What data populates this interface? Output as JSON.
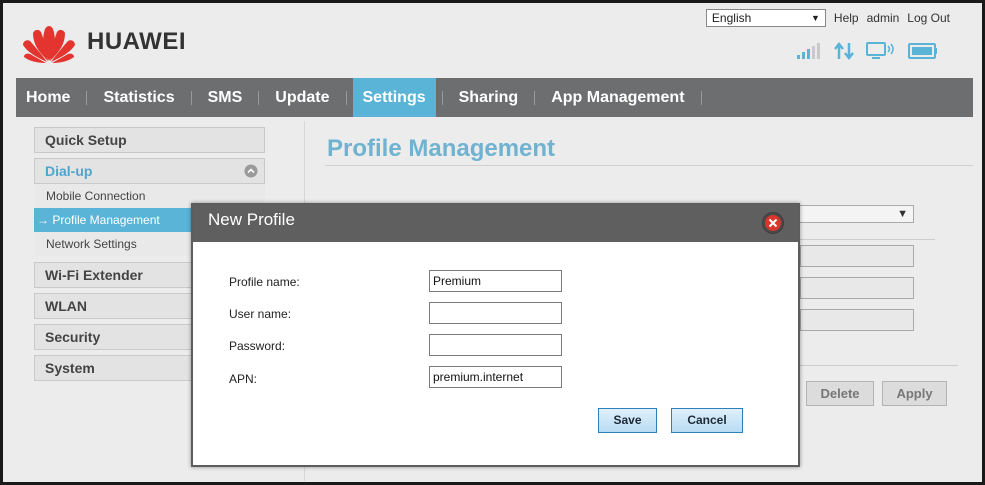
{
  "header": {
    "brand": "HUAWEI",
    "language": "English",
    "links": {
      "help": "Help",
      "user": "admin",
      "logout": "Log Out"
    }
  },
  "nav": {
    "items": [
      {
        "label": "Home"
      },
      {
        "label": "Statistics"
      },
      {
        "label": "SMS"
      },
      {
        "label": "Update"
      },
      {
        "label": "Settings",
        "active": true
      },
      {
        "label": "Sharing"
      },
      {
        "label": "App Management"
      }
    ]
  },
  "sidebar": {
    "quick_setup": "Quick Setup",
    "dialup": "Dial-up",
    "dialup_items": [
      "Mobile Connection",
      "→ Profile Management",
      "Network Settings"
    ],
    "wifi_extender": "Wi-Fi Extender",
    "wlan": "WLAN",
    "security": "Security",
    "system": "System"
  },
  "main": {
    "title": "Profile Management",
    "delete_label": "Delete",
    "apply_label": "Apply"
  },
  "modal": {
    "title": "New Profile",
    "fields": [
      {
        "label": "Profile name:",
        "value": "Premium"
      },
      {
        "label": "User name:",
        "value": ""
      },
      {
        "label": "Password:",
        "value": ""
      },
      {
        "label": "APN:",
        "value": "premium.internet"
      }
    ],
    "save_label": "Save",
    "cancel_label": "Cancel"
  },
  "colors": {
    "accent": "#5ab4d8",
    "nav_bg": "#6c6e6f",
    "brand_red": "#e3342f"
  }
}
